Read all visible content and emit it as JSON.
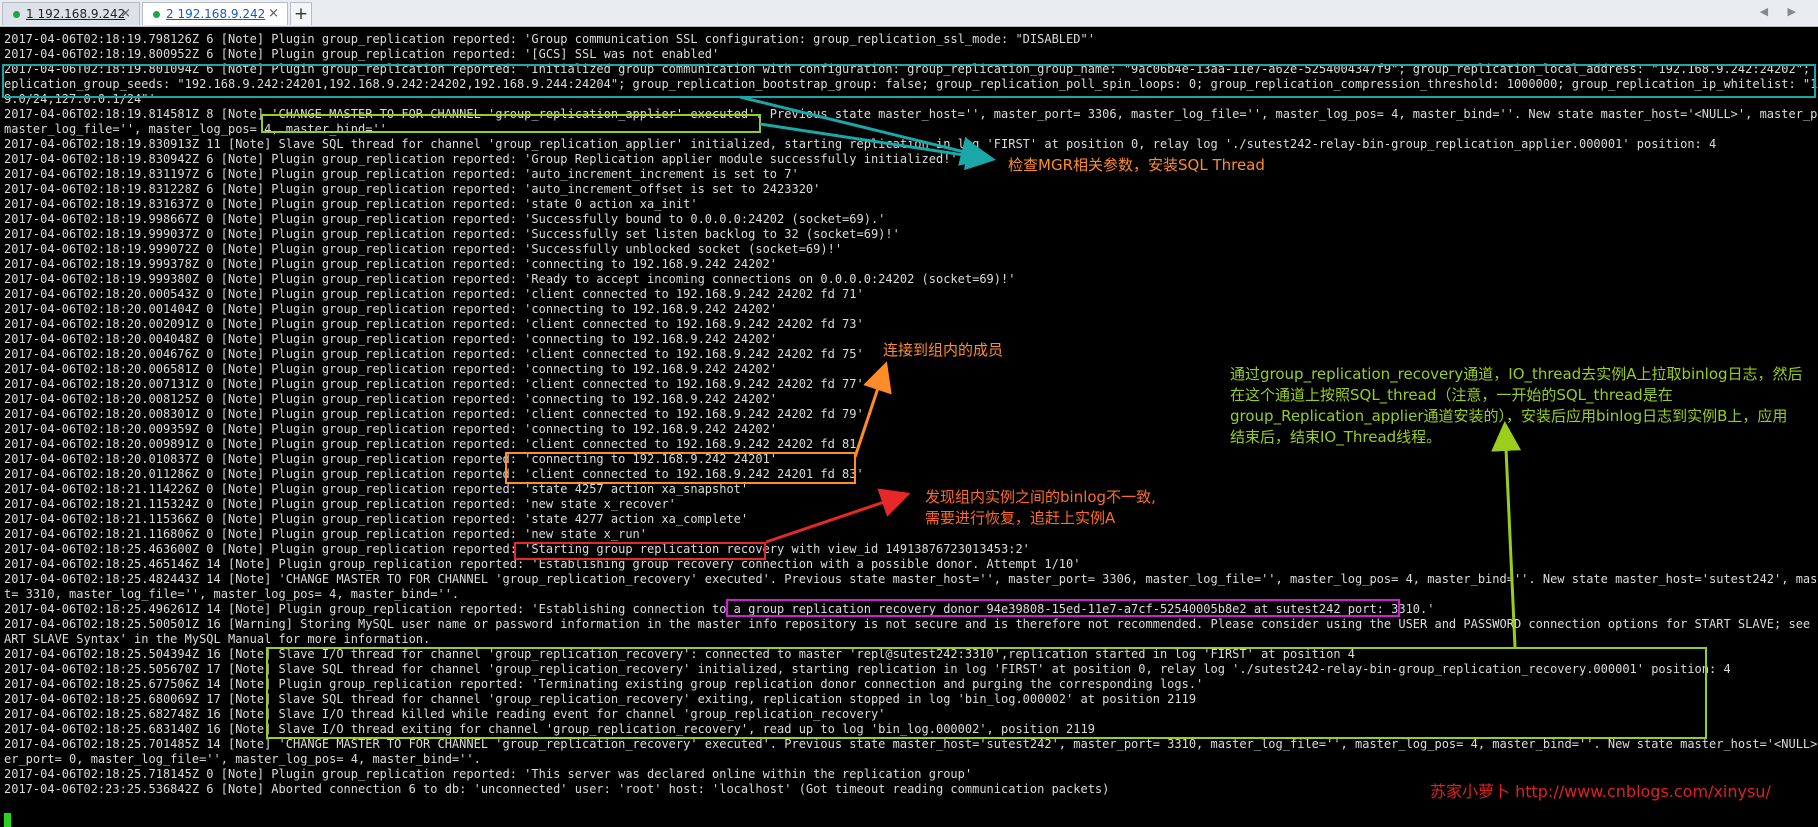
{
  "tabs": [
    {
      "label": "1 192.168.9.242",
      "close": "×"
    },
    {
      "label": "2 192.168.9.242",
      "close": "×"
    }
  ],
  "new_tab": "+",
  "nav": "◀ ▶",
  "log_lines": [
    "2017-04-06T02:18:19.798126Z 6 [Note] Plugin group_replication reported: 'Group communication SSL configuration: group_replication_ssl_mode: \"DISABLED\"'",
    "2017-04-06T02:18:19.800952Z 6 [Note] Plugin group_replication reported: '[GCS] SSL was not enabled'",
    "2017-04-06T02:18:19.801094Z 6 [Note] Plugin group_replication reported: 'Initialized group communication with configuration: group_replication_group_name: \"9ac06b4e-13aa-11e7-a62e-5254004347f9\"; group_replication_local_address: \"192.168.9.242:24202\"; group_r",
    "eplication_group_seeds: \"192.168.9.242:24201,192.168.9.242:24202,192.168.9.244:24204\"; group_replication_bootstrap_group: false; group_replication_poll_spin_loops: 0; group_replication_compression_threshold: 1000000; group_replication_ip_whitelist: \"192.168.",
    "9.0/24,127.0.0.1/24\"'",
    "2017-04-06T02:18:19.814581Z 8 [Note] 'CHANGE MASTER TO FOR CHANNEL 'group_replication_applier' executed'. Previous state master_host='', master_port= 3306, master_log_file='', master_log_pos= 4, master_bind=''. New state master_host='<NULL>', master_port= 0,",
    "master_log_file='', master_log_pos= 4, master_bind=''.",
    "2017-04-06T02:18:19.830913Z 11 [Note] Slave SQL thread for channel 'group_replication_applier' initialized, starting replication in log 'FIRST' at position 0, relay log './sutest242-relay-bin-group_replication_applier.000001' position: 4",
    "2017-04-06T02:18:19.830942Z 6 [Note] Plugin group_replication reported: 'Group Replication applier module successfully initialized!'",
    "2017-04-06T02:18:19.831197Z 6 [Note] Plugin group_replication reported: 'auto_increment_increment is set to 7'",
    "2017-04-06T02:18:19.831228Z 6 [Note] Plugin group_replication reported: 'auto_increment_offset is set to 2423320'",
    "2017-04-06T02:18:19.831637Z 0 [Note] Plugin group_replication reported: 'state 0 action xa_init'",
    "2017-04-06T02:18:19.998667Z 0 [Note] Plugin group_replication reported: 'Successfully bound to 0.0.0.0:24202 (socket=69).'",
    "2017-04-06T02:18:19.999037Z 0 [Note] Plugin group_replication reported: 'Successfully set listen backlog to 32 (socket=69)!'",
    "2017-04-06T02:18:19.999072Z 0 [Note] Plugin group_replication reported: 'Successfully unblocked socket (socket=69)!'",
    "2017-04-06T02:18:19.999378Z 0 [Note] Plugin group_replication reported: 'connecting to 192.168.9.242 24202'",
    "2017-04-06T02:18:19.999380Z 0 [Note] Plugin group_replication reported: 'Ready to accept incoming connections on 0.0.0.0:24202 (socket=69)!'",
    "2017-04-06T02:18:20.000543Z 0 [Note] Plugin group_replication reported: 'client connected to 192.168.9.242 24202 fd 71'",
    "2017-04-06T02:18:20.001404Z 0 [Note] Plugin group_replication reported: 'connecting to 192.168.9.242 24202'",
    "2017-04-06T02:18:20.002091Z 0 [Note] Plugin group_replication reported: 'client connected to 192.168.9.242 24202 fd 73'",
    "2017-04-06T02:18:20.004048Z 0 [Note] Plugin group_replication reported: 'connecting to 192.168.9.242 24202'",
    "2017-04-06T02:18:20.004676Z 0 [Note] Plugin group_replication reported: 'client connected to 192.168.9.242 24202 fd 75'",
    "2017-04-06T02:18:20.006581Z 0 [Note] Plugin group_replication reported: 'connecting to 192.168.9.242 24202'",
    "2017-04-06T02:18:20.007131Z 0 [Note] Plugin group_replication reported: 'client connected to 192.168.9.242 24202 fd 77'",
    "2017-04-06T02:18:20.008125Z 0 [Note] Plugin group_replication reported: 'connecting to 192.168.9.242 24202'",
    "2017-04-06T02:18:20.008301Z 0 [Note] Plugin group_replication reported: 'client connected to 192.168.9.242 24202 fd 79'",
    "2017-04-06T02:18:20.009359Z 0 [Note] Plugin group_replication reported: 'connecting to 192.168.9.242 24202'",
    "2017-04-06T02:18:20.009891Z 0 [Note] Plugin group_replication reported: 'client connected to 192.168.9.242 24202 fd 81'",
    "2017-04-06T02:18:20.010837Z 0 [Note] Plugin group_replication reported: 'connecting to 192.168.9.242 24201'",
    "2017-04-06T02:18:20.011286Z 0 [Note] Plugin group_replication reported: 'client connected to 192.168.9.242 24201 fd 83'",
    "2017-04-06T02:18:21.114226Z 0 [Note] Plugin group_replication reported: 'state 4257 action xa_snapshot'",
    "2017-04-06T02:18:21.115324Z 0 [Note] Plugin group_replication reported: 'new state x_recover'",
    "2017-04-06T02:18:21.115366Z 0 [Note] Plugin group_replication reported: 'state 4277 action xa_complete'",
    "2017-04-06T02:18:21.116806Z 0 [Note] Plugin group_replication reported: 'new state x_run'",
    "2017-04-06T02:18:25.463600Z 0 [Note] Plugin group_replication reported: 'Starting group replication recovery with view_id 14913876723013453:2'",
    "2017-04-06T02:18:25.465146Z 14 [Note] Plugin group_replication reported: 'Establishing group recovery connection with a possible donor. Attempt 1/10'",
    "2017-04-06T02:18:25.482443Z 14 [Note] 'CHANGE MASTER TO FOR CHANNEL 'group_replication_recovery' executed'. Previous state master_host='', master_port= 3306, master_log_file='', master_log_pos= 4, master_bind=''. New state master_host='sutest242', master_por",
    "t= 3310, master_log_file='', master_log_pos= 4, master_bind=''.",
    "2017-04-06T02:18:25.496261Z 14 [Note] Plugin group_replication reported: 'Establishing connection to a group replication recovery donor 94e39808-15ed-11e7-a7cf-52540005b8e2 at sutest242 port: 3310.'",
    "2017-04-06T02:18:25.500501Z 16 [Warning] Storing MySQL user name or password information in the master info repository is not secure and is therefore not recommended. Please consider using the USER and PASSWORD connection options for START SLAVE; see the 'ST",
    "ART SLAVE Syntax' in the MySQL Manual for more information.",
    "2017-04-06T02:18:25.504394Z 16 [Note] Slave I/O thread for channel 'group_replication_recovery': connected to master 'repl@sutest242:3310',replication started in log 'FIRST' at position 4",
    "2017-04-06T02:18:25.505670Z 17 [Note] Slave SQL thread for channel 'group_replication_recovery' initialized, starting replication in log 'FIRST' at position 0, relay log './sutest242-relay-bin-group_replication_recovery.000001' position: 4",
    "2017-04-06T02:18:25.677506Z 14 [Note] Plugin group_replication reported: 'Terminating existing group replication donor connection and purging the corresponding logs.'",
    "2017-04-06T02:18:25.680069Z 17 [Note] Slave SQL thread for channel 'group_replication_recovery' exiting, replication stopped in log 'bin_log.000002' at position 2119",
    "2017-04-06T02:18:25.682748Z 16 [Note] Slave I/O thread killed while reading event for channel 'group_replication_recovery'",
    "2017-04-06T02:18:25.683140Z 16 [Note] Slave I/O thread exiting for channel 'group_replication_recovery', read up to log 'bin_log.000002', position 2119",
    "2017-04-06T02:18:25.701485Z 14 [Note] 'CHANGE MASTER TO FOR CHANNEL 'group_replication_recovery' executed'. Previous state master_host='sutest242', master_port= 3310, master_log_file='', master_log_pos= 4, master_bind=''. New state master_host='<NULL>', mast",
    "er_port= 0, master_log_file='', master_log_pos= 4, master_bind=''.",
    "2017-04-06T02:18:25.718145Z 0 [Note] Plugin group_replication reported: 'This server was declared online within the replication group'",
    "2017-04-06T02:23:25.536842Z 6 [Note] Aborted connection 6 to db: 'unconnected' user: 'root' host: 'localhost' (Got timeout reading communication packets)"
  ],
  "annotations": {
    "note1": "检查MGR相关参数，安装SQL Thread",
    "note2": "连接到组内的成员",
    "note3_line1": "发现组内实例之间的binlog不一致,",
    "note3_line2": "需要进行恢复，追赶上实例A",
    "note4_line1": "通过group_replication_recovery通道，IO_thread去实例A上拉取binlog日志，然后",
    "note4_line2": "在这个通道上按照SQL_thread（注意，一开始的SQL_thread是在",
    "note4_line3": "group_Replication_applier通道安装的），安装后应用binlog日志到实例B上，应用",
    "note4_line4": "结束后，结束IO_Thread线程。",
    "watermark": "苏家小萝卜 http://www.cnblogs.com/xinysu/"
  },
  "colors": {
    "teal": "#1aa7a8",
    "yellow_green": "#9acd1c",
    "orange": "#ff8c28",
    "red": "#e62828",
    "magenta": "#d21cd2",
    "watermark": "#e02020",
    "terminal_text": "#dcdcdc",
    "terminal_bg": "#000000"
  }
}
